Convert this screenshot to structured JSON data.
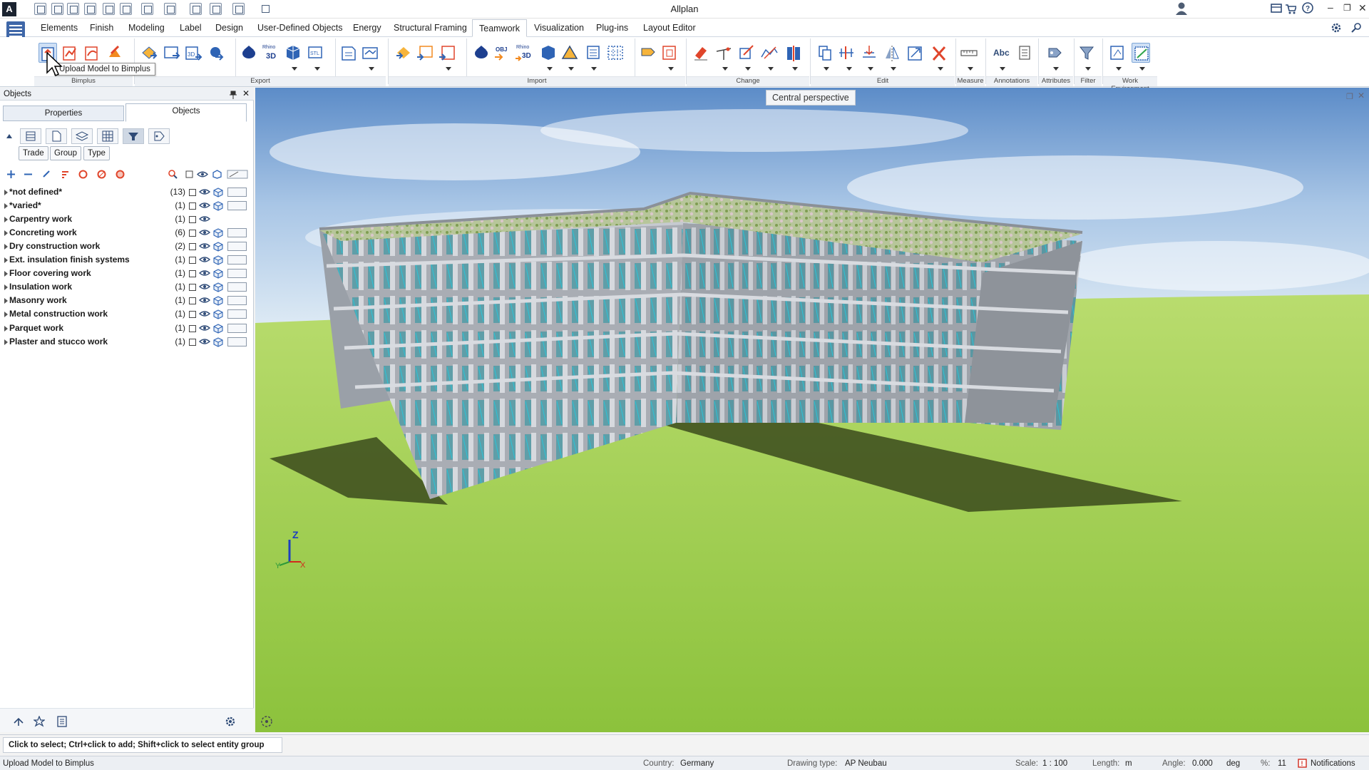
{
  "app": {
    "title": "Allplan",
    "logo": "A"
  },
  "menu": {
    "tabs": [
      "Elements",
      "Finish",
      "Modeling",
      "Label",
      "Design",
      "User-Defined Objects",
      "Energy",
      "Structural Framing",
      "Teamwork",
      "Visualization",
      "Plug-ins",
      "Layout Editor"
    ],
    "active": "Teamwork"
  },
  "ribbon": {
    "groups": [
      "Bimplus",
      "Export",
      "Import",
      "Change",
      "Edit",
      "Measure",
      "Annotations",
      "Attributes",
      "Filter",
      "Work Environment"
    ],
    "tooltip": "Upload Model to Bimplus",
    "labels": {
      "rhino": "Rhino",
      "obj": "OBJ",
      "abc": "Abc",
      "three_d": "3D",
      "stl": "STL"
    }
  },
  "panel": {
    "title": "Objects",
    "tabs": [
      "Properties",
      "Objects"
    ],
    "active_tab": "Objects",
    "chips": [
      "Trade",
      "Group",
      "Type"
    ],
    "rows": [
      {
        "label": "*not defined*",
        "count": "(13)"
      },
      {
        "label": "*varied*",
        "count": "(1)"
      },
      {
        "label": "Carpentry work",
        "count": "(1)"
      },
      {
        "label": "Concreting work",
        "count": "(6)"
      },
      {
        "label": "Dry construction work",
        "count": "(2)"
      },
      {
        "label": "Ext. insulation finish systems",
        "count": "(1)"
      },
      {
        "label": "Floor covering work",
        "count": "(1)"
      },
      {
        "label": "Insulation work",
        "count": "(1)"
      },
      {
        "label": "Masonry work",
        "count": "(1)"
      },
      {
        "label": "Metal construction work",
        "count": "(1)"
      },
      {
        "label": "Parquet work",
        "count": "(1)"
      },
      {
        "label": "Plaster and stucco work",
        "count": "(1)"
      }
    ]
  },
  "viewport": {
    "projection": "Central perspective",
    "axis": {
      "z": "Z",
      "x": "X",
      "y": "Y"
    }
  },
  "command_line": "Click to select; Ctrl+click to add; Shift+click to select entity group",
  "status": {
    "message": "Upload Model to Bimplus",
    "country_label": "Country:",
    "country": "Germany",
    "drawing_type_label": "Drawing type:",
    "drawing_type": "AP Neubau",
    "scale_label": "Scale:",
    "scale": "1 : 100",
    "length_label": "Length:",
    "length": "m",
    "angle_label": "Angle:",
    "angle": "0.000",
    "angle_unit": "deg",
    "percent_label": "%:",
    "percent": "11",
    "notifications": "Notifications"
  },
  "colors": {
    "accent": "#1f5fa8",
    "ribbon_group_bg": "#eef1f5",
    "lawn": "#9acb46",
    "sky": "#5c8cc8"
  }
}
